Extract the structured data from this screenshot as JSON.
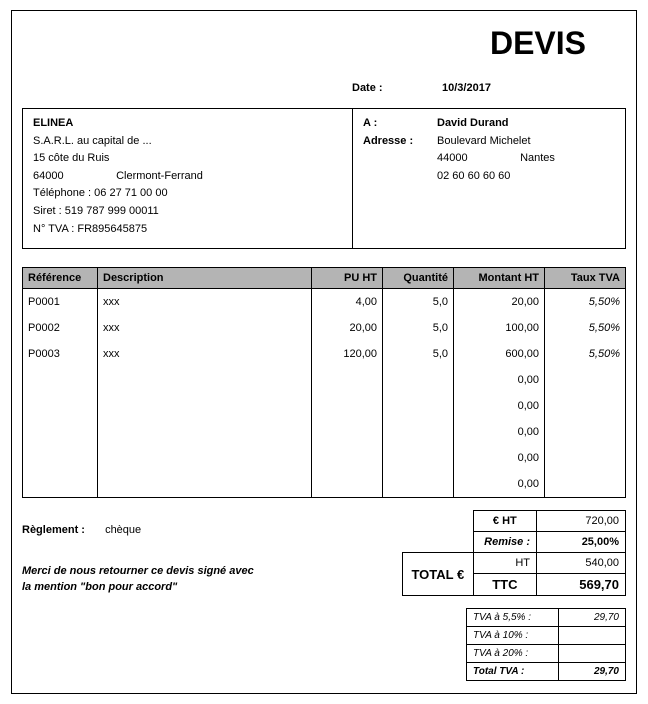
{
  "title": "DEVIS",
  "date_label": "Date :",
  "date_value": "10/3/2017",
  "sender": {
    "name": "ELINEA",
    "legal": "S.A.R.L. au capital de ...",
    "address": "15 côte du Ruis",
    "postal": "64000",
    "city": "Clermont-Ferrand",
    "phone_label": "Téléphone :",
    "phone": "06 27 71 00 00",
    "siret_label": "Siret :",
    "siret": "519 787 999 00011",
    "vat_label": "N° TVA :",
    "vat": "FR895645875"
  },
  "recipient": {
    "to_label": "A :",
    "addr_label": "Adresse :",
    "name": "David Durand",
    "street": "Boulevard Michelet",
    "postal": "44000",
    "city": "Nantes",
    "phone": "02 60 60 60 60"
  },
  "columns": {
    "ref": "Référence",
    "desc": "Description",
    "pu": "PU HT",
    "qty": "Quantité",
    "mht": "Montant HT",
    "tva": "Taux TVA"
  },
  "items": [
    {
      "ref": "P0001",
      "desc": "xxx",
      "pu": "4,00",
      "qty": "5,0",
      "mht": "20,00",
      "tva": "5,50%"
    },
    {
      "ref": "P0002",
      "desc": "xxx",
      "pu": "20,00",
      "qty": "5,0",
      "mht": "100,00",
      "tva": "5,50%"
    },
    {
      "ref": "P0003",
      "desc": "xxx",
      "pu": "120,00",
      "qty": "5,0",
      "mht": "600,00",
      "tva": "5,50%"
    },
    {
      "ref": "",
      "desc": "",
      "pu": "",
      "qty": "",
      "mht": "0,00",
      "tva": ""
    },
    {
      "ref": "",
      "desc": "",
      "pu": "",
      "qty": "",
      "mht": "0,00",
      "tva": ""
    },
    {
      "ref": "",
      "desc": "",
      "pu": "",
      "qty": "",
      "mht": "0,00",
      "tva": ""
    },
    {
      "ref": "",
      "desc": "",
      "pu": "",
      "qty": "",
      "mht": "0,00",
      "tva": ""
    },
    {
      "ref": "",
      "desc": "",
      "pu": "",
      "qty": "",
      "mht": "0,00",
      "tva": ""
    }
  ],
  "payment": {
    "label": "Règlement :",
    "value": "chèque"
  },
  "note_line1": "Merci de nous retourner ce devis signé avec",
  "note_line2": "la mention \"bon pour accord\"",
  "totals": {
    "eht_label": "€ HT",
    "eht": "720,00",
    "remise_label": "Remise :",
    "remise": "25,00%",
    "total_label": "TOTAL €",
    "ht_label": "HT",
    "ht": "540,00",
    "ttc_label": "TTC",
    "ttc": "569,70"
  },
  "tva_box": {
    "r1_label": "TVA à 5,5% :",
    "r1_val": "29,70",
    "r2_label": "TVA à 10% :",
    "r2_val": "",
    "r3_label": "TVA à 20% :",
    "r3_val": "",
    "tot_label": "Total TVA :",
    "tot_val": "29,70"
  }
}
